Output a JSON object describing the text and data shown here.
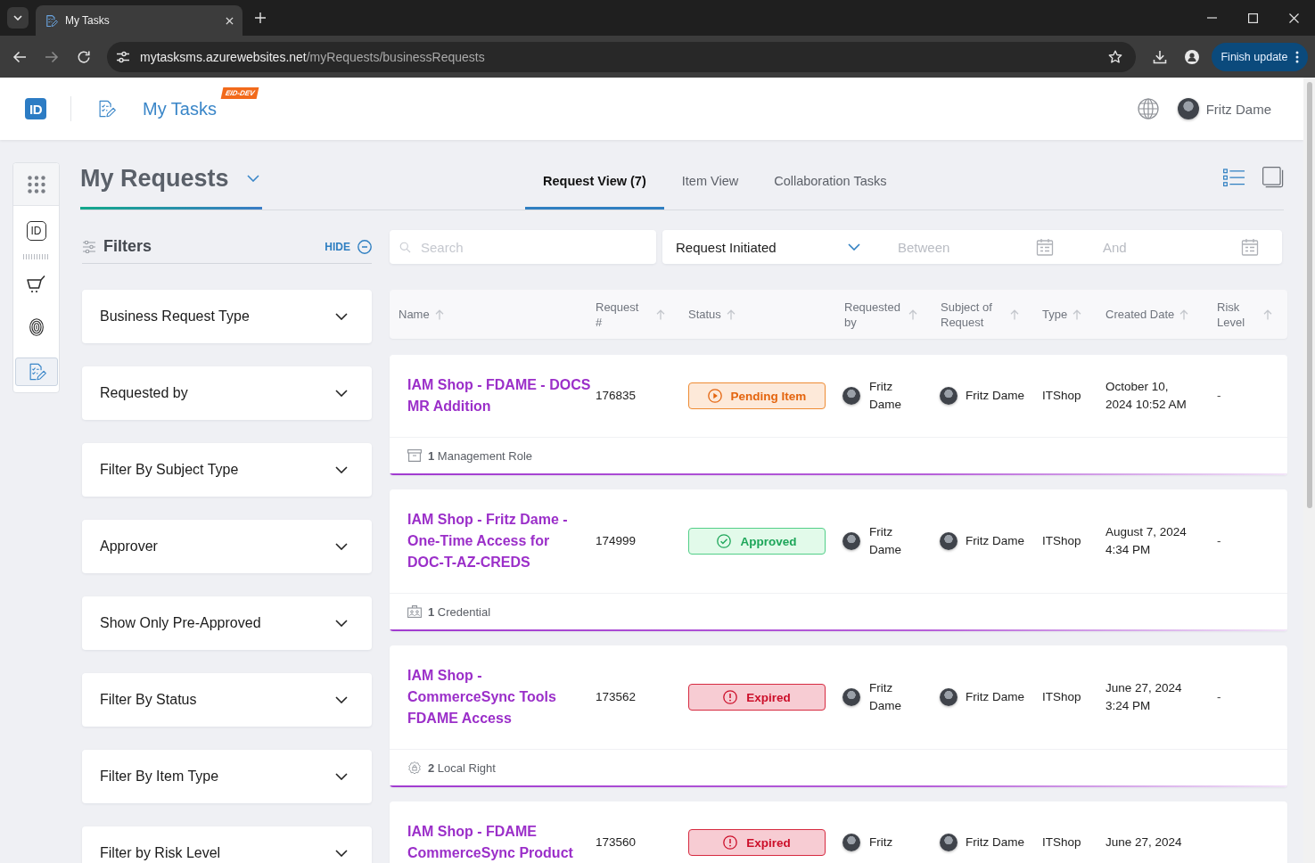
{
  "browser": {
    "tab_title": "My Tasks",
    "url_host": "mytasksms.azurewebsites.net",
    "url_path": "/myRequests/businessRequests",
    "update_button": "Finish update"
  },
  "header": {
    "logo_text": "ID",
    "app_title": "My Tasks",
    "env_badge": "EID-DEV",
    "user_name": "Fritz Dame"
  },
  "rail": {
    "items": [
      {
        "kind": "id",
        "label": "ID",
        "selected": false
      },
      {
        "kind": "cart",
        "selected": false
      },
      {
        "kind": "fingerprint",
        "selected": false
      },
      {
        "kind": "tasks",
        "selected": true
      }
    ]
  },
  "page": {
    "title": "My Requests",
    "tabs": [
      {
        "label": "Request View (7)",
        "selected": true
      },
      {
        "label": "Item View",
        "selected": false
      },
      {
        "label": "Collaboration Tasks",
        "selected": false
      }
    ],
    "view_modes": [
      {
        "kind": "list",
        "selected": true
      },
      {
        "kind": "cards",
        "selected": false
      }
    ]
  },
  "filters": {
    "title": "Filters",
    "hide_label": "HIDE",
    "items": [
      {
        "label": "Business Request Type",
        "expanded": false
      },
      {
        "label": "Requested by",
        "expanded": false
      },
      {
        "label": "Filter By Subject Type",
        "expanded": false
      },
      {
        "label": "Approver",
        "expanded": false
      },
      {
        "label": "Show Only Pre-Approved",
        "expanded": false
      },
      {
        "label": "Filter By Status",
        "expanded": false
      },
      {
        "label": "Filter By Item Type",
        "expanded": false
      },
      {
        "label": "Filter by Risk Level",
        "expanded": false
      }
    ]
  },
  "search": {
    "placeholder": "Search"
  },
  "date_filter": {
    "field": "Request Initiated",
    "from_placeholder": "Between",
    "to_placeholder": "And"
  },
  "table": {
    "columns": [
      "Name",
      "Request #",
      "Status",
      "Requested by",
      "Subject of Request",
      "Type",
      "Created Date",
      "Risk Level"
    ],
    "rows": [
      {
        "name": "IAM Shop - FDAME - DOCS MR Addition",
        "request_no": "176835",
        "status": {
          "kind": "pending",
          "label": "Pending Item"
        },
        "requested_by": "Fritz Dame",
        "subject": "Fritz Dame",
        "type": "ITShop",
        "created": "October 10, 2024 10:52 AM",
        "risk": "-",
        "items": {
          "kind": "role",
          "text": "**1** Management Role"
        }
      },
      {
        "name": "IAM Shop - Fritz Dame - One-Time Access for DOC-T-AZ-CREDS",
        "request_no": "174999",
        "status": {
          "kind": "approved",
          "label": "Approved"
        },
        "requested_by": "Fritz Dame",
        "subject": "Fritz Dame",
        "type": "ITShop",
        "created": "August 7, 2024 4:34 PM",
        "risk": "-",
        "items": {
          "kind": "credential",
          "text": "**1** Credential"
        }
      },
      {
        "name": "IAM Shop - CommerceSync Tools FDAME Access",
        "request_no": "173562",
        "status": {
          "kind": "expired",
          "label": "Expired"
        },
        "requested_by": "Fritz Dame",
        "subject": "Fritz Dame",
        "type": "ITShop",
        "created": "June 27, 2024 3:24 PM",
        "risk": "-",
        "items": {
          "kind": "local-right",
          "text": "**2** Local Right"
        }
      },
      {
        "name": "IAM Shop - FDAME CommerceSync Product",
        "request_no": "173560",
        "status": {
          "kind": "expired",
          "label": "Expired"
        },
        "requested_by": "Fritz",
        "subject": "Fritz Dame",
        "type": "ITShop",
        "created": "June 27, 2024"
      }
    ]
  }
}
